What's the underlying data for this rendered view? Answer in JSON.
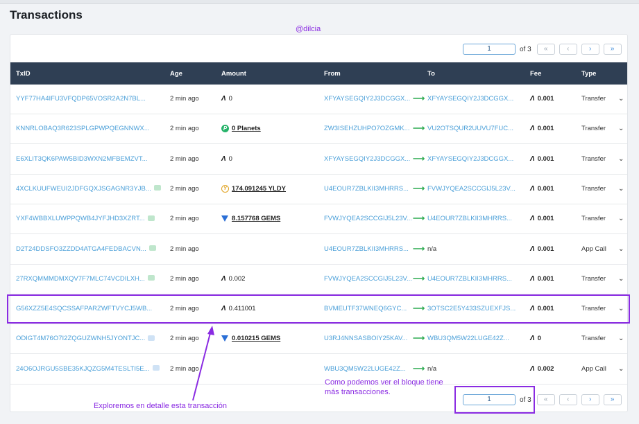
{
  "page": {
    "title": "Transactions",
    "handle": "@dilcia"
  },
  "pager": {
    "page": "1",
    "of_label": "of 3",
    "buttons": [
      "«",
      "‹",
      "›",
      "»"
    ]
  },
  "table": {
    "headers": [
      "TxID",
      "Age",
      "Amount",
      "From",
      "To",
      "Fee",
      "Type"
    ],
    "rows": [
      {
        "txid": "YYF77HA4IFU3VFQDP65VOSR2A2N7BL...",
        "tag": "",
        "age": "2 min ago",
        "amount_icon": "algo-icon",
        "amount": "0",
        "amount_link": false,
        "from": "XFYAYSEGQIY2J3DCGGX...",
        "to": "XFYAYSEGQIY2J3DCGGX...",
        "to_link": true,
        "fee": "0.001",
        "type": "Transfer"
      },
      {
        "txid": "KNNRLOBAQ3R623SPLGPWPQEGNNWX...",
        "tag": "",
        "age": "2 min ago",
        "amount_icon": "planet-icon",
        "amount": "0 Planets",
        "amount_link": true,
        "from": "ZW3ISEHZUHPO7OZGMK...",
        "to": "VU2OTSQUR2UUVU7FUC...",
        "to_link": true,
        "fee": "0.001",
        "type": "Transfer"
      },
      {
        "txid": "E6XLIT3QK6PAW5BID3WXN2MFBEMZVT...",
        "tag": "",
        "age": "2 min ago",
        "amount_icon": "algo-icon",
        "amount": "0",
        "amount_link": false,
        "from": "XFYAYSEGQIY2J3DCGGX...",
        "to": "XFYAYSEGQIY2J3DCGGX...",
        "to_link": true,
        "fee": "0.001",
        "type": "Transfer"
      },
      {
        "txid": "4XCLKUUFWEUI2JDFGQXJSGAGNR3YJB...",
        "tag": "green",
        "age": "2 min ago",
        "amount_icon": "yldy-icon",
        "amount": "174.091245 YLDY",
        "amount_link": true,
        "from": "U4EOUR7ZBLKII3MHRRS...",
        "to": "FVWJYQEA2SCCGIJ5L23V...",
        "to_link": true,
        "fee": "0.001",
        "type": "Transfer"
      },
      {
        "txid": "YXF4WBBXLUWPPQWB4JYFJHD3XZRT...",
        "tag": "green",
        "age": "2 min ago",
        "amount_icon": "gem-icon",
        "amount": "8.157768 GEMS",
        "amount_link": true,
        "from": "FVWJYQEA2SCCGIJ5L23V...",
        "to": "U4EOUR7ZBLKII3MHRRS...",
        "to_link": true,
        "fee": "0.001",
        "type": "Transfer"
      },
      {
        "txid": "D2T24DDSFO3ZZDD4ATGA4FEDBACVN...",
        "tag": "green",
        "age": "2 min ago",
        "amount_icon": "",
        "amount": "",
        "amount_link": false,
        "from": "U4EOUR7ZBLKII3MHRRS...",
        "to": "n/a",
        "to_link": false,
        "fee": "0.001",
        "type": "App Call"
      },
      {
        "txid": "27RXQMMMDMXQV7F7MLC74VCDILXH...",
        "tag": "green",
        "age": "2 min ago",
        "amount_icon": "algo-icon",
        "amount": "0.002",
        "amount_link": false,
        "from": "FVWJYQEA2SCCGIJ5L23V...",
        "to": "U4EOUR7ZBLKII3MHRRS...",
        "to_link": true,
        "fee": "0.001",
        "type": "Transfer"
      },
      {
        "txid": "G56XZZ5E4SQCSSAFPARZWFTVYCJ5WB...",
        "tag": "",
        "age": "2 min ago",
        "amount_icon": "algo-icon",
        "amount": "0.411001",
        "amount_link": false,
        "from": "BVMEUTF37WNEQ6GYC...",
        "to": "3OTSC2E5Y433SZUEXFJS...",
        "to_link": true,
        "fee": "0.001",
        "type": "Transfer"
      },
      {
        "txid": "ODIGT4M76O7I2ZQGUZWNH5JYONTJC...",
        "tag": "blue",
        "age": "2 min ago",
        "amount_icon": "gem-icon",
        "amount": "0.010215 GEMS",
        "amount_link": true,
        "from": "U3RJ4NNSASBOIY25KAV...",
        "to": "WBU3QM5W22LUGE42Z...",
        "to_link": true,
        "fee": "0",
        "type": "Transfer"
      },
      {
        "txid": "24O6OJRGU5SBE35KJQZG5M4TESLTI5E...",
        "tag": "blue",
        "age": "2 min ago",
        "amount_icon": "",
        "amount": "",
        "amount_link": false,
        "from": "WBU3QM5W22LUGE42Z...",
        "to": "n/a",
        "to_link": false,
        "fee": "0.002",
        "type": "App Call"
      }
    ]
  },
  "annotations": {
    "arrow_note": "Exploremos en detalle esta transacción",
    "pager_note": "Como podemos ver el bloque tiene más transacciones."
  },
  "colors": {
    "header_bg": "#2f3f54",
    "link": "#4a9fd8",
    "annotation": "#8a2be2",
    "arrow": "#2eab52"
  }
}
